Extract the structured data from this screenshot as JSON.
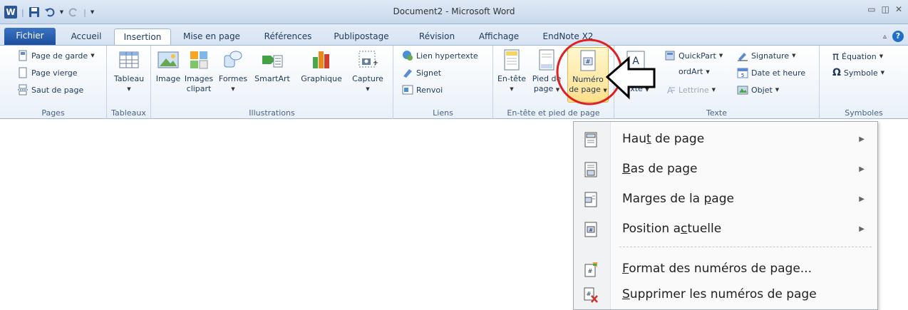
{
  "window": {
    "title": "Document2 - Microsoft Word",
    "app_letter": "W"
  },
  "tabs": [
    {
      "label": "Fichier"
    },
    {
      "label": "Accueil"
    },
    {
      "label": "Insertion"
    },
    {
      "label": "Mise en page"
    },
    {
      "label": "Références"
    },
    {
      "label": "Publipostage"
    },
    {
      "label": "Révision"
    },
    {
      "label": "Affichage"
    },
    {
      "label": "EndNote X2"
    }
  ],
  "help_symbol": "?",
  "groups": {
    "pages": {
      "label": "Pages",
      "items": [
        "Page de garde",
        "Page vierge",
        "Saut de page"
      ]
    },
    "tableaux": {
      "label": "Tableaux",
      "tableau": "Tableau"
    },
    "illustrations": {
      "label": "Illustrations",
      "image": "Image",
      "images_clipart_1": "Images",
      "images_clipart_2": "clipart",
      "formes": "Formes",
      "smartart": "SmartArt",
      "graphique": "Graphique",
      "capture": "Capture"
    },
    "liens": {
      "label": "Liens",
      "items": [
        "Lien hypertexte",
        "Signet",
        "Renvoi"
      ]
    },
    "entete": {
      "label": "En-tête et pied de page",
      "entete": "En-tête",
      "pied_1": "Pied de",
      "pied_2": "page",
      "numero_1": "Numéro",
      "numero_2": "de page"
    },
    "texte": {
      "label": "Texte",
      "zone": "texte",
      "quickpart": "QuickPart",
      "wordart": "ordArt",
      "lettrine": "Lettrine",
      "signature": "Signature",
      "date": "Date et heure",
      "objet": "Objet"
    },
    "symboles": {
      "label": "Symboles",
      "equation": "Équation",
      "symbole": "Symbole"
    }
  },
  "menu": {
    "items": [
      {
        "pre": "Hau",
        "ul": "t",
        "post": " de page",
        "submenu": true
      },
      {
        "pre": "",
        "ul": "B",
        "post": "as de page",
        "submenu": true
      },
      {
        "pre": "Marges de la ",
        "ul": "p",
        "post": "age",
        "submenu": true
      },
      {
        "pre": "Position a",
        "ul": "c",
        "post": "tuelle",
        "submenu": true
      },
      {
        "pre": "",
        "ul": "F",
        "post": "ormat des numéros de page...",
        "submenu": false
      },
      {
        "pre": "",
        "ul": "S",
        "post": "upprimer les numéros de page",
        "submenu": false
      }
    ],
    "submenu_arrow": "▶"
  },
  "annotation": {
    "circle_color": "#e02020",
    "arrow_color": "#000000"
  }
}
